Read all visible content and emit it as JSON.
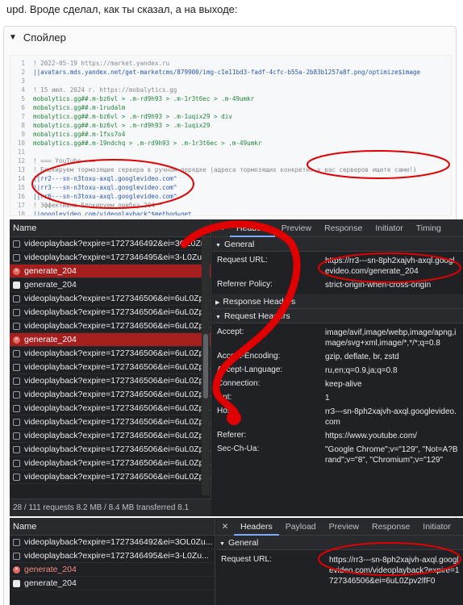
{
  "intro": "upd. Вроде сделал, как ты сказал, а на выходе:",
  "spoiler": {
    "title": "Спойлер"
  },
  "code": [
    {
      "n": "1",
      "t": "! 2022-05-19 https://market.yandex.ru",
      "c": "comment"
    },
    {
      "n": "2",
      "t": "||avatars.mds.yandex.net/get-marketcms/879900/img-c1e11bd3-fadf-4cfc-b55a-2b83b1257a8f.png/optimize$image",
      "c": "url"
    },
    {
      "n": "3",
      "t": "",
      "c": "dom"
    },
    {
      "n": "4",
      "t": "! 15 июл. 2024 г. https://mobalytics.gg",
      "c": "comment"
    },
    {
      "n": "5",
      "t": "mobalytics.gg##.m-bz6vl > .m-rd9h93 > .m-1r3t6ec > .m-49umkr",
      "c": "green"
    },
    {
      "n": "6",
      "t": "mobalytics.gg##.m-1rudalm",
      "c": "green"
    },
    {
      "n": "7",
      "t": "mobalytics.gg##.m-bz6vl > .m-rd9h93 > .m-1uqix29 > div",
      "c": "green"
    },
    {
      "n": "8",
      "t": "mobalytics.gg##.m-bz6vl > .m-rd9h93 > .m-1uqix29",
      "c": "green"
    },
    {
      "n": "9",
      "t": "mobalytics.gg##.m-1fxs7o4",
      "c": "green"
    },
    {
      "n": "10",
      "t": "mobalytics.gg##.m-19ndchq > .m-rd9h93 > .m-1r3t6ec > .m-49umkr",
      "c": "green"
    },
    {
      "n": "11",
      "t": "",
      "c": "dom"
    },
    {
      "n": "12",
      "t": "! === YouTube ===",
      "c": "comment"
    },
    {
      "n": "13",
      "t": "! Блокируем тормозящие сервера в ручном порядке (адреса тормозящих конкретно у вас серверов ищите сами!)",
      "c": "comment"
    },
    {
      "n": "14",
      "t": "||rr2---sn-n3toxu-axql.googlevideo.com^",
      "c": "url"
    },
    {
      "n": "15",
      "t": "||rr3---sn-n3toxu-axql.googlevideo.com^",
      "c": "url"
    },
    {
      "n": "16",
      "t": "||rr6---sn-n3toxu-axql.googlevideo.com^",
      "c": "url"
    },
    {
      "n": "17",
      "t": "! Эффективно блокируем ошибку 204 *",
      "c": "comment"
    },
    {
      "n": "18",
      "t": "||googlevideo.com/videoplayback^$method=get",
      "c": "url"
    }
  ],
  "devtools_top": {
    "name_header": "Name",
    "requests": [
      {
        "label": "videoplayback?expire=1727346492&ei=3OL0Zu",
        "type": "doc",
        "err": false
      },
      {
        "label": "videoplayback?expire=1727346495&ei=3-L0Zu...",
        "type": "doc",
        "err": false
      },
      {
        "label": "generate_204",
        "type": "x",
        "err": true
      },
      {
        "label": "generate_204",
        "type": "page",
        "err": false
      },
      {
        "label": "videoplayback?expire=1727346506&ei=6uL0Zp...",
        "type": "doc",
        "err": false
      },
      {
        "label": "videoplayback?expire=1727346506&ei=6uL0Zp...",
        "type": "doc",
        "err": false
      },
      {
        "label": "videoplayback?expire=1727346506&ei=6uL0Zp...",
        "type": "doc",
        "err": false
      },
      {
        "label": "generate_204",
        "type": "x",
        "err": true
      },
      {
        "label": "videoplayback?expire=1727346506&ei=6uL0Zp...",
        "type": "doc",
        "err": false
      },
      {
        "label": "videoplayback?expire=1727346506&ei=6uL0Zp...",
        "type": "doc",
        "err": false
      },
      {
        "label": "videoplayback?expire=1727346506&ei=6uL0Zp...",
        "type": "doc",
        "err": false
      },
      {
        "label": "videoplayback?expire=1727346506&ei=6uL0Zp...",
        "type": "doc",
        "err": false
      },
      {
        "label": "videoplayback?expire=1727346506&ei=6uL0Zp...",
        "type": "doc",
        "err": false
      },
      {
        "label": "videoplayback?expire=1727346506&ei=6uL0Zp...",
        "type": "doc",
        "err": false
      },
      {
        "label": "videoplayback?expire=1727346506&ei=6uL0Zp...",
        "type": "doc",
        "err": false
      },
      {
        "label": "videoplayback?expire=1727346506&ei=6uL0Zp...",
        "type": "doc",
        "err": false
      },
      {
        "label": "videoplayback?expire=1727346506&ei=6uL0Zp...",
        "type": "doc",
        "err": false
      },
      {
        "label": "videoplayback?expire=1727346506&ei=6uL0Zp...",
        "type": "doc",
        "err": false
      }
    ],
    "status": "28 / 111 requests   8.2 MB / 8.4 MB transferred   8.1",
    "tabs": [
      "Headers",
      "Preview",
      "Response",
      "Initiator",
      "Timing"
    ],
    "general_label": "General",
    "general": [
      {
        "k": "Request URL:",
        "v": "https://rr3---sn-8ph2xajvh-axql.googlevideo.com/generate_204"
      },
      {
        "k": "Referrer Policy:",
        "v": "strict-origin-when-cross-origin"
      }
    ],
    "response_headers_label": "Response Headers",
    "request_headers_label": "Request Headers",
    "request_headers": [
      {
        "k": "Accept:",
        "v": "image/avif,image/webp,image/apng,image/svg+xml,image/*,*/*;q=0.8"
      },
      {
        "k": "Accept-Encoding:",
        "v": "gzip, deflate, br, zstd"
      },
      {
        "k": "Accept-Language:",
        "v": "ru,en;q=0.9,ja;q=0.8"
      },
      {
        "k": "Connection:",
        "v": "keep-alive"
      },
      {
        "k": "Dnt:",
        "v": "1"
      },
      {
        "k": "Host:",
        "v": "rr3---sn-8ph2xajvh-axql.googlevideo.com"
      },
      {
        "k": "Referer:",
        "v": "https://www.youtube.com/"
      },
      {
        "k": "Sec-Ch-Ua:",
        "v": "\"Google Chrome\";v=\"129\", \"Not=A?Brand\";v=\"8\", \"Chromium\";v=\"129\""
      }
    ]
  },
  "devtools_bottom": {
    "name_header": "Name",
    "requests": [
      {
        "label": "videoplayback?expire=1727346492&ei=3OL0Zu...",
        "type": "doc",
        "err": false
      },
      {
        "label": "videoplayback?expire=1727346495&ei=3-L0Zu...",
        "type": "doc",
        "err": false
      },
      {
        "label": "generate_204",
        "type": "x",
        "err": false,
        "red": true
      },
      {
        "label": "generate_204",
        "type": "page",
        "err": false
      }
    ],
    "tabs": [
      "Headers",
      "Payload",
      "Preview",
      "Response",
      "Initiator"
    ],
    "general_label": "General",
    "request_url_key": "Request URL:",
    "request_url_value": "https://rr3---sn-8ph2xajvh-axql.googlevideo.com/videoplayback?expire=1727346506&ei=6uL0Zpv2lfF0"
  }
}
